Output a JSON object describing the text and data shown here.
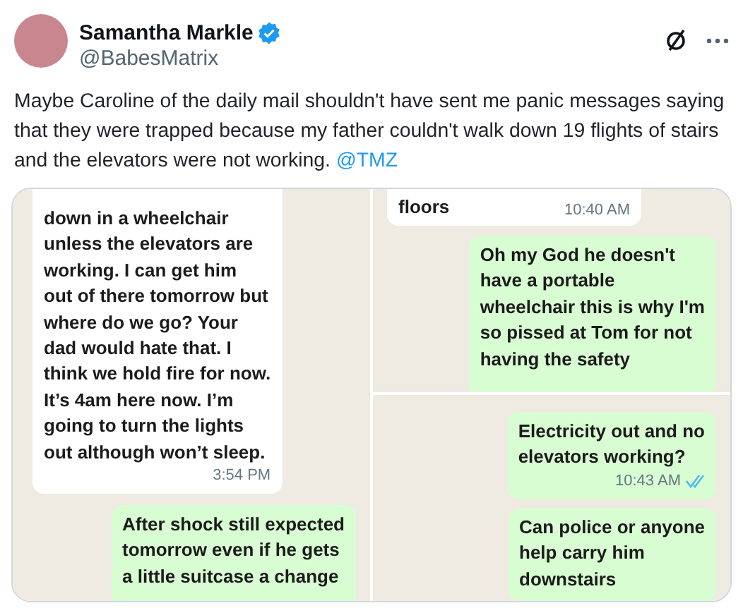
{
  "author": {
    "name": "Samantha Markle",
    "handle": "@BabesMatrix",
    "verified": true
  },
  "text": "Maybe Caroline of the daily mail shouldn't have sent me panic messages saying that they were trapped because my father couldn't walk down 19 flights of stairs and the elevators were not working.",
  "mention": "@TMZ",
  "media": {
    "panels": [
      {
        "messages": [
          {
            "kind": "received",
            "text": "down in a wheelchair\nunless the elevators are\nworking.  I can get him\nout of there tomorrow but\nwhere do we go? Your\ndad would hate that. I\nthink we hold fire for now.\nIt’s 4am here now. I’m\ngoing to turn the lights\nout although won’t sleep.",
            "time": "3:54 PM"
          },
          {
            "kind": "sent",
            "text": "After shock still expected\ntomorrow even if he gets\na little suitcase a change"
          }
        ]
      },
      {
        "messages": [
          {
            "kind": "received",
            "text": "floors",
            "time": "10:40 AM"
          },
          {
            "kind": "sent",
            "text": "Oh my God he doesn't\nhave a portable\nwheelchair this is why I'm\nso pissed at Tom for not\nhaving the safety"
          }
        ]
      },
      {
        "messages": [
          {
            "kind": "sent",
            "text": "Electricity out and no\nelevators working?",
            "time": "10:43 AM",
            "read": true
          },
          {
            "kind": "sent",
            "text": "Can police or anyone\nhelp carry him\ndownstairs"
          }
        ]
      }
    ]
  }
}
